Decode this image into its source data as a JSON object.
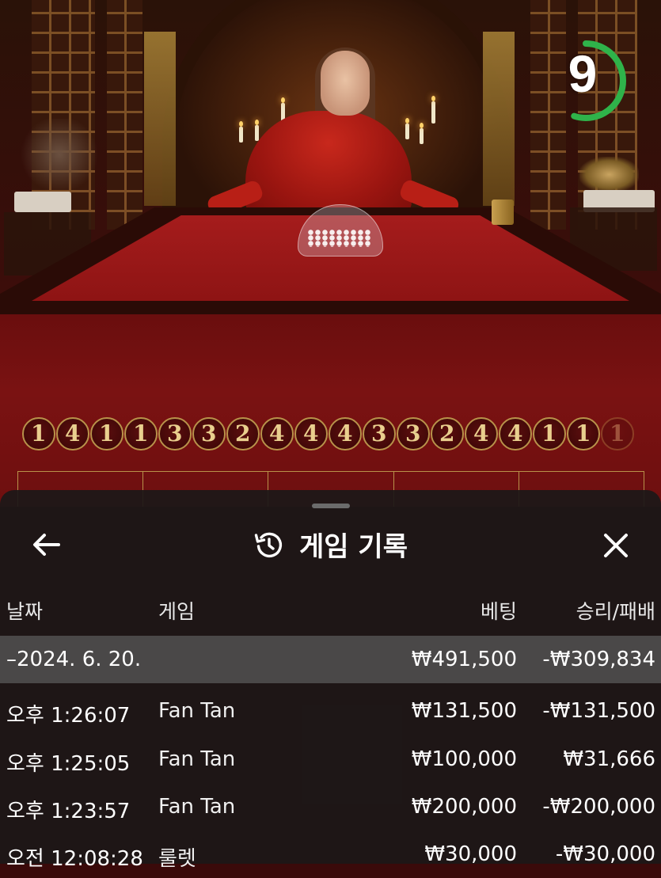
{
  "timer": {
    "value": "9",
    "progress": 0.55,
    "color": "#2fb34a"
  },
  "results": [
    "1",
    "4",
    "1",
    "1",
    "3",
    "3",
    "2",
    "4",
    "4",
    "4",
    "3",
    "3",
    "2",
    "4",
    "4",
    "1",
    "1",
    "1"
  ],
  "sheet": {
    "title": "게임 기록",
    "title_icon": "history-icon",
    "back_icon": "arrow-left-icon",
    "close_icon": "close-icon"
  },
  "table": {
    "headers": {
      "date": "날짜",
      "game": "게임",
      "bet": "베팅",
      "win_loss": "승리/패배"
    },
    "day_group": {
      "date": "–2024. 6. 20.",
      "bet": "₩491,500",
      "win_loss": "-₩309,834"
    },
    "rows": [
      {
        "time": "오후 1:26:07",
        "game": "Fan Tan",
        "bet": "₩131,500",
        "win_loss": "-₩131,500"
      },
      {
        "time": "오후 1:25:05",
        "game": "Fan Tan",
        "bet": "₩100,000",
        "win_loss": "₩31,666"
      },
      {
        "time": "오후 1:23:57",
        "game": "Fan Tan",
        "bet": "₩200,000",
        "win_loss": "-₩200,000"
      },
      {
        "time": "오전 12:08:28",
        "game": "룰렛",
        "bet": "₩30,000",
        "win_loss": "-₩30,000"
      }
    ]
  }
}
